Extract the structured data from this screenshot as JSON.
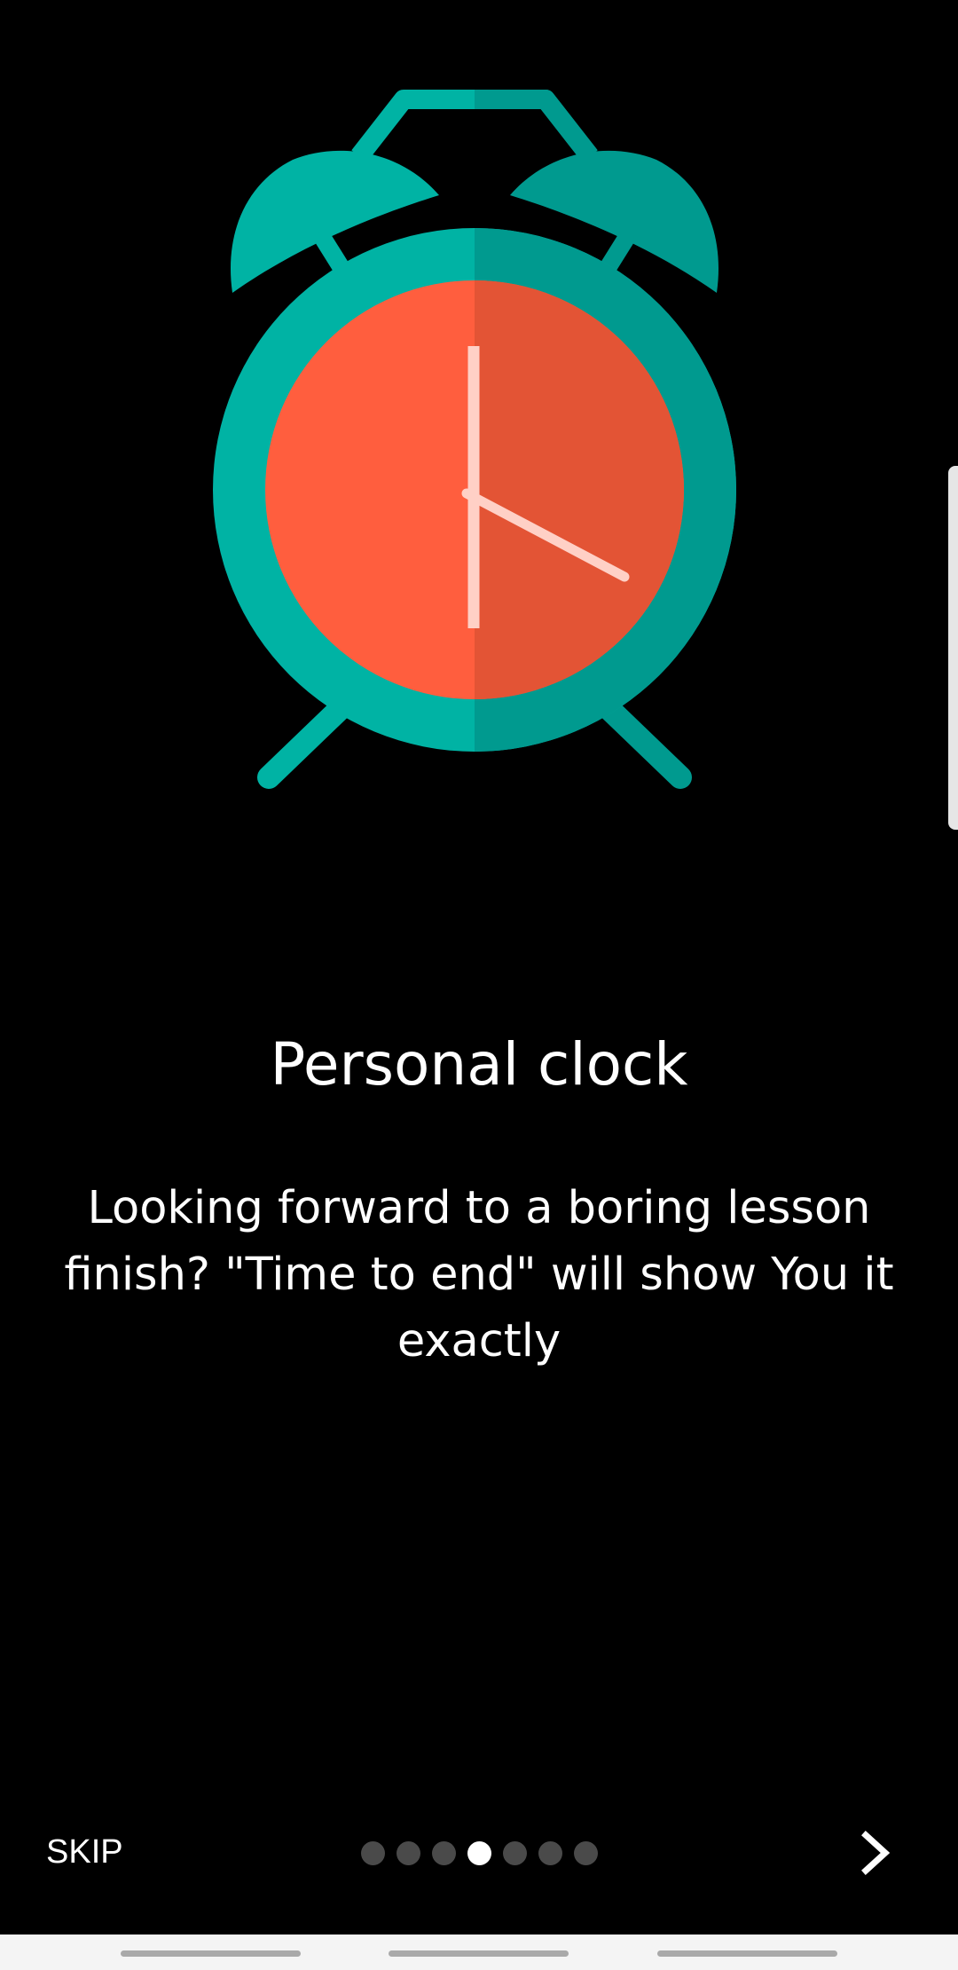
{
  "slide": {
    "title": "Personal clock",
    "description": "Looking forward to a boring lesson finish? \"Time to end\" will show You it exactly",
    "illustration_icon": "alarm-clock-icon"
  },
  "footer": {
    "skip_label": "SKIP",
    "next_icon": "chevron-right-icon",
    "page_count": 7,
    "current_page": 4
  },
  "colors": {
    "background": "#000000",
    "clock_teal": "#00b3a4",
    "clock_teal_dark": "#009a8f",
    "clock_face": "#ff5e3e",
    "clock_face_dark": "#e35435",
    "hands": "#ffd0c6",
    "dot_active": "#ffffff",
    "dot_inactive": "#4a4a4a"
  }
}
